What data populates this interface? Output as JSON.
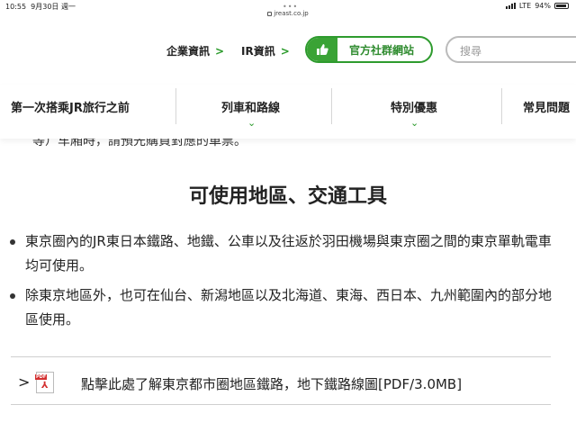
{
  "statusbar": {
    "time": "10:55",
    "date": "9月30日 週一",
    "url": "jreast.co.jp",
    "network": "LTE",
    "battery": "94%",
    "battery_level": 0.94
  },
  "header": {
    "corp_link": "企業資訊",
    "ir_link": "IR資訊",
    "social_button": "官方社群網站",
    "search_placeholder": "搜尋"
  },
  "nav": {
    "items": [
      {
        "label": "第一次搭乘JR旅行之前"
      },
      {
        "label": "列車和路線"
      },
      {
        "label": "特別優惠"
      },
      {
        "label": "常見問題"
      }
    ]
  },
  "content": {
    "cut_off_text": "等）车廂時，請預先購買對應的車票。",
    "section_title": "可使用地區、交通工具",
    "bullets": [
      "東京圈內的JR東日本鐵路、地鐵、公車以及往返於羽田機場與東京圈之間的東京單軌電車均可使用。",
      "除東京地區外，也可在仙台、新潟地區以及北海道、東海、西日本、九州範圍內的部分地區使用。"
    ],
    "pdf_link": "點擊此處了解東京都市圈地區鐵路，地下鐵路線圖[PDF/3.0MB]",
    "pdf_badge": "PDF"
  },
  "colors": {
    "accent_green": "#2e9b2e",
    "pdf_red": "#d32f2f"
  }
}
